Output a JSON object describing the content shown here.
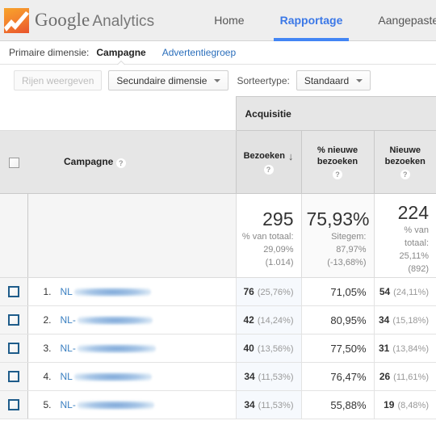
{
  "header": {
    "logo_icon": "google-analytics-logo-icon",
    "brand_google": "Google",
    "brand_analytics": "Analytics",
    "nav": [
      {
        "label": "Home",
        "active": false
      },
      {
        "label": "Rapportage",
        "active": true
      },
      {
        "label": "Aangepaste rapporten",
        "active": false
      }
    ],
    "accent_color": "#4285f4"
  },
  "dimension_bar": {
    "label": "Primaire dimensie:",
    "primary": "Campagne",
    "secondary_link": "Advertentiegroep"
  },
  "toolbar": {
    "rows_button": "Rijen weergeven",
    "secondary_dimension_button": "Secundaire dimensie",
    "sort_label": "Sorteertype:",
    "sort_value": "Standaard"
  },
  "table": {
    "group_header": "Acquisitie",
    "columns": {
      "name": "Campagne",
      "m1_line1": "Bezoeken",
      "m2_line1": "% nieuwe",
      "m2_line2": "bezoeken",
      "m3_line1": "Nieuwe",
      "m3_line2": "bezoeken",
      "help_glyph": "?",
      "sort_arrow": "↓"
    },
    "summary": {
      "visits": {
        "value": "295",
        "l1": "% van totaal:",
        "l2": "29,09%",
        "l3": "(1.014)"
      },
      "new_pct": {
        "value": "75,93%",
        "l1": "Sitegem:",
        "l2": "87,97%",
        "l3": "(-13,68%)"
      },
      "new_visits": {
        "value": "224",
        "l1": "% van",
        "l2": "totaal:",
        "l3": "25,11%",
        "l4": "(892)"
      }
    },
    "rows": [
      {
        "rank": "1.",
        "prefix": "NL",
        "redact_width": 95,
        "visits": "76",
        "visits_pct": "(25,76%)",
        "new_pct": "71,05%",
        "new_visits": "54",
        "new_visits_pct": "(24,11%)"
      },
      {
        "rank": "2.",
        "prefix": "NL-",
        "redact_width": 93,
        "visits": "42",
        "visits_pct": "(14,24%)",
        "new_pct": "80,95%",
        "new_visits": "34",
        "new_visits_pct": "(15,18%)"
      },
      {
        "rank": "3.",
        "prefix": "NL-",
        "redact_width": 97,
        "visits": "40",
        "visits_pct": "(13,56%)",
        "new_pct": "77,50%",
        "new_visits": "31",
        "new_visits_pct": "(13,84%)"
      },
      {
        "rank": "4.",
        "prefix": "NL",
        "redact_width": 96,
        "visits": "34",
        "visits_pct": "(11,53%)",
        "new_pct": "76,47%",
        "new_visits": "26",
        "new_visits_pct": "(11,61%)"
      },
      {
        "rank": "5.",
        "prefix": "NL-",
        "redact_width": 95,
        "visits": "34",
        "visits_pct": "(11,53%)",
        "new_pct": "55,88%",
        "new_visits": "19",
        "new_visits_pct": "(8,48%)"
      }
    ]
  }
}
